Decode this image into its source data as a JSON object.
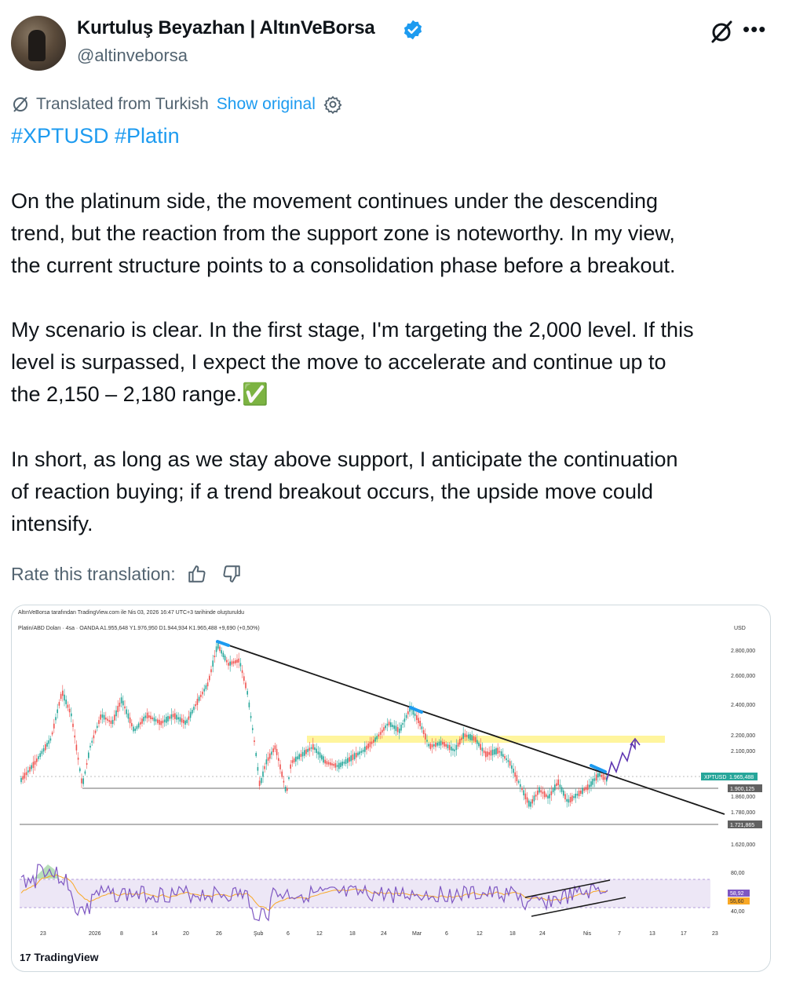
{
  "author": {
    "name": "Kurtuluş Beyazhan | AltınVeBorsa",
    "handle": "@altinveborsa"
  },
  "translation": {
    "translated_from": "Translated from Turkish",
    "show_original": "Show original",
    "rate_label": "Rate this translation:"
  },
  "tweet": {
    "hashtags": "#XPTUSD #Platin",
    "paragraphs": [
      [
        "On the platinum side, the movement continues under the descending",
        "trend, but the reaction from the support zone is noteworthy. In my view,",
        "the current structure points to a consolidation phase before a breakout."
      ],
      [
        "My scenario is clear. In the first stage, I'm targeting the 2,000 level. If this",
        "level is surpassed, I expect the move to accelerate and continue up to",
        "the 2,150 – 2,180 range.✅"
      ],
      [
        "In short, as long as we stay above support, I anticipate the continuation",
        "of reaction buying; if a trend breakout occurs, the upside move could",
        "intensify."
      ]
    ]
  },
  "chart": {
    "header_line": "AltınVeBorsa tarafından TradingView.com ile Nis 03, 2026 16:47 UTC+3 tarihinde oluşturuldu",
    "symbol_line": "Platin/ABD Doları · 4sa · OANDA  A1.955,648  Y1.976,950  D1.944,934  K1.965,488  +9,690 (+0,50%)",
    "currency": "USD",
    "brand": "TradingView",
    "price_ticks": [
      "2.800,000",
      "2.600,000",
      "2.400,000",
      "2.200,000",
      "2.100,000",
      "1.860,000",
      "1.780,000",
      "1.620,000"
    ],
    "price_tag_label": "XPTUSD",
    "price_tag_value": "1.965,488",
    "support_tag_1": "1.900,125",
    "support_tag_2": "1.721,865",
    "rsi_ticks": [
      "80,00",
      "40,00"
    ],
    "rsi_tag_1": "58,92",
    "rsi_tag_2": "55,60",
    "x_ticks": [
      "23",
      "2026",
      "8",
      "14",
      "20",
      "26",
      "Şub",
      "6",
      "12",
      "18",
      "24",
      "Mar",
      "6",
      "12",
      "18",
      "24",
      "Nis",
      "7",
      "13",
      "17",
      "23"
    ],
    "colors": {
      "up": "#26a69a",
      "down": "#ef5350",
      "trend_line": "#1a1a1a",
      "target_zone": "#fff59d",
      "rsi_band": "#ede7f6",
      "rsi_line": "#7e57c2",
      "rsi_ma": "#f9a825",
      "brand_blue": "#1d9bf0"
    }
  }
}
